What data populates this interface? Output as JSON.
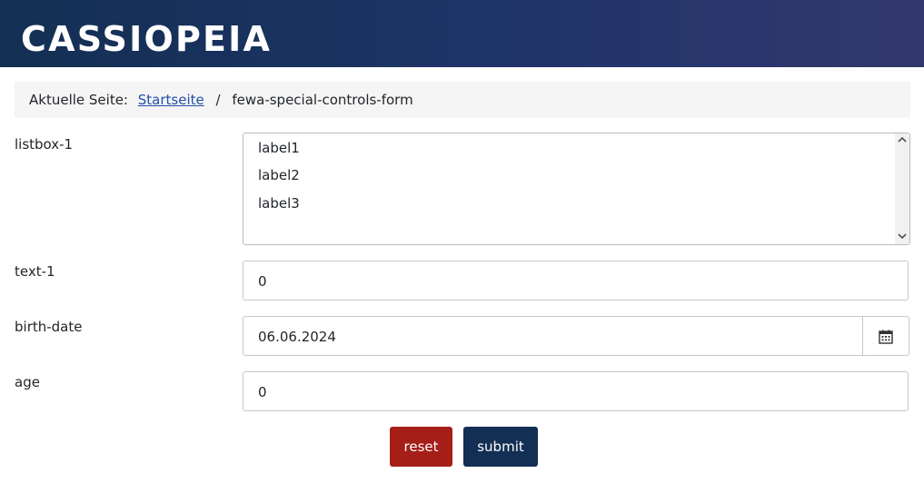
{
  "header": {
    "brand": "CASSIOPEIA"
  },
  "breadcrumb": {
    "prefix": "Aktuelle Seite:",
    "home_link": "Startseite",
    "separator": "/",
    "current": "fewa-special-controls-form"
  },
  "form": {
    "listbox": {
      "label": "listbox-1",
      "options": [
        "label1",
        "label2",
        "label3"
      ]
    },
    "text1": {
      "label": "text-1",
      "value": "0"
    },
    "birth_date": {
      "label": "birth-date",
      "value": "06.06.2024",
      "button_icon": "calendar-icon"
    },
    "age": {
      "label": "age",
      "value": "0"
    }
  },
  "buttons": {
    "reset_label": "reset",
    "submit_label": "submit"
  },
  "colors": {
    "header_start": "#132f53",
    "header_end": "#33386e",
    "link": "#224faa",
    "reset": "#a51f18",
    "submit": "#132f53"
  }
}
